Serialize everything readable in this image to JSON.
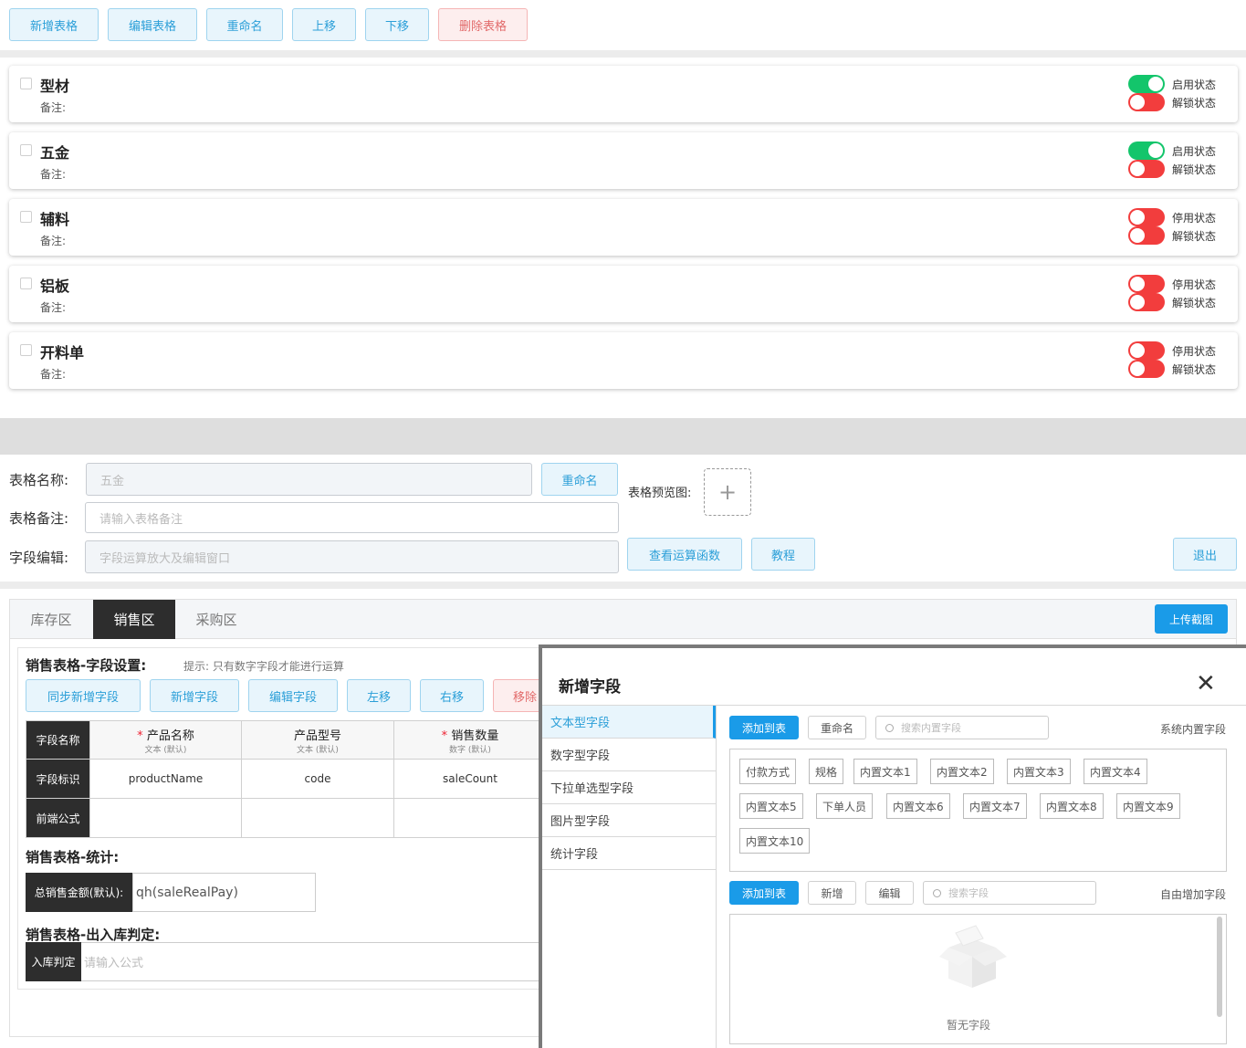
{
  "toolbar": {
    "add": "新增表格",
    "edit": "编辑表格",
    "rename": "重命名",
    "up": "上移",
    "down": "下移",
    "delete": "删除表格"
  },
  "tables": [
    {
      "name": "型材",
      "remark": "备注:",
      "state1": "启用状态",
      "state1_on": true,
      "state2": "解锁状态"
    },
    {
      "name": "五金",
      "remark": "备注:",
      "state1": "启用状态",
      "state1_on": true,
      "state2": "解锁状态"
    },
    {
      "name": "辅料",
      "remark": "备注:",
      "state1": "停用状态",
      "state1_on": false,
      "state2": "解锁状态"
    },
    {
      "name": "铝板",
      "remark": "备注:",
      "state1": "停用状态",
      "state1_on": false,
      "state2": "解锁状态"
    },
    {
      "name": "开料单",
      "remark": "备注:",
      "state1": "停用状态",
      "state1_on": false,
      "state2": "解锁状态"
    }
  ],
  "form": {
    "name_label": "表格名称:",
    "name_value": "五金",
    "rename_btn": "重命名",
    "preview_label": "表格预览图:",
    "preview_plus": "+",
    "remark_label": "表格备注:",
    "remark_placeholder": "请输入表格备注",
    "field_edit_label": "字段编辑:",
    "field_edit_placeholder": "字段运算放大及编辑窗口",
    "view_func_btn": "查看运算函数",
    "tutorial_btn": "教程",
    "exit_btn": "退出"
  },
  "tabs": [
    "库存区",
    "销售区",
    "采购区"
  ],
  "upload_screenshot": "上传截图",
  "sales": {
    "settings_title": "销售表格-字段设置:",
    "hint": "提示: 只有数字字段才能进行运算",
    "buttons": [
      "同步新增字段",
      "新增字段",
      "编辑字段",
      "左移",
      "右移",
      "移除"
    ],
    "row_headers": [
      "字段名称",
      "字段标识",
      "前端公式"
    ],
    "columns": [
      {
        "required": "*",
        "name": "产品名称",
        "sub": "文本 (默认)",
        "key": "productName"
      },
      {
        "required": "",
        "name": "产品型号",
        "sub": "文本 (默认)",
        "key": "code"
      },
      {
        "required": "*",
        "name": "销售数量",
        "sub": "数字 (默认)",
        "key": "saleCount"
      }
    ],
    "stats_title": "销售表格-统计:",
    "stats_label": "总销售金额(默认):",
    "stats_value": "qh(saleRealPay)",
    "io_title": "销售表格-出入库判定:",
    "io_label": "入库判定",
    "io_placeholder": "请输入公式"
  },
  "modal": {
    "title": "新增字段",
    "close": "✕",
    "side": [
      "文本型字段",
      "数字型字段",
      "下拉单选型字段",
      "图片型字段",
      "统计字段"
    ],
    "add_to_table": "添加到表",
    "rename": "重命名",
    "search_builtin": "搜索内置字段",
    "builtin_caption": "系统内置字段",
    "chips": [
      "付款方式",
      "规格",
      "内置文本1",
      "内置文本2",
      "内置文本3",
      "内置文本4",
      "内置文本5",
      "下单人员",
      "内置文本6",
      "内置文本7",
      "内置文本8",
      "内置文本9",
      "内置文本10"
    ],
    "add_to_table2": "添加到表",
    "new": "新增",
    "edit": "编辑",
    "search_field": "搜索字段",
    "free_caption": "自由增加字段",
    "empty": "暂无字段"
  }
}
